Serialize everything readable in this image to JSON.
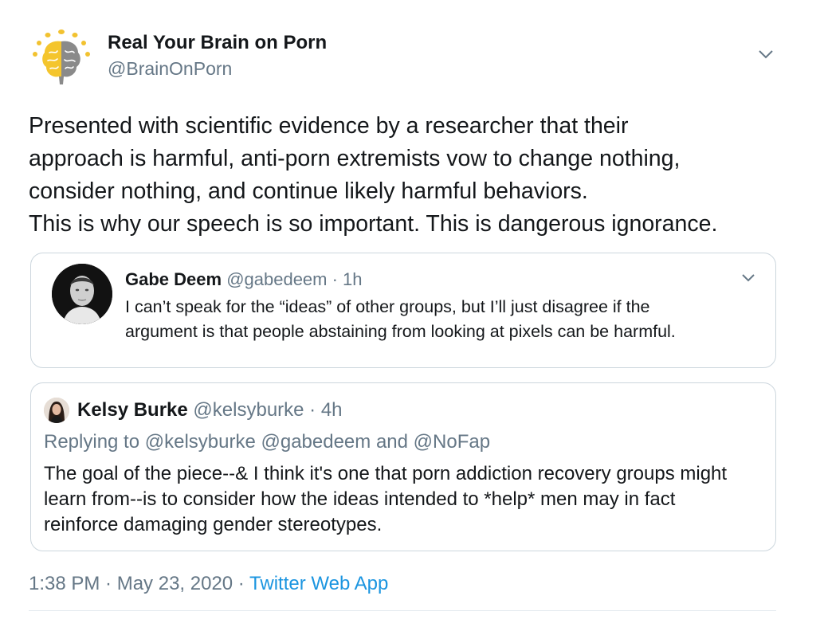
{
  "author": {
    "display_name": "Real Your Brain on Porn",
    "handle": "@BrainOnPorn"
  },
  "tweet": {
    "lines": [
      "Presented with scientific evidence by a researcher that their",
      "approach is harmful, anti-porn extremists vow to change nothing,",
      "consider nothing, and continue likely harmful behaviors.",
      "This is why our speech is so important. This is dangerous ignorance."
    ]
  },
  "quote1": {
    "name": "Gabe Deem",
    "meta": "@gabedeem · 1h",
    "lines": [
      "I can’t speak for the “ideas” of other groups, but I’ll just disagree if the",
      "argument is that people abstaining from looking at pixels can be harmful."
    ]
  },
  "quote2": {
    "name": "Kelsy Burke",
    "meta": "@kelsyburke · 4h",
    "replying": "Replying to @kelsyburke @gabedeem and @NoFap",
    "lines": [
      "The goal of the piece--& I think it's one that porn addiction recovery groups might",
      "learn from--is to consider how the ideas intended to *help* men may in fact",
      "reinforce damaging gender stereotypes."
    ]
  },
  "footer": {
    "timestamp": "1:38 PM · May 23, 2020 · ",
    "source": "Twitter Web App"
  },
  "icons": {
    "main_avatar": "brain-sun-logo-icon",
    "caret": "chevron-down-icon"
  },
  "colors": {
    "text": "#14171a",
    "secondary": "#657786",
    "link": "#1b95e0",
    "border": "#ccd6dd"
  }
}
